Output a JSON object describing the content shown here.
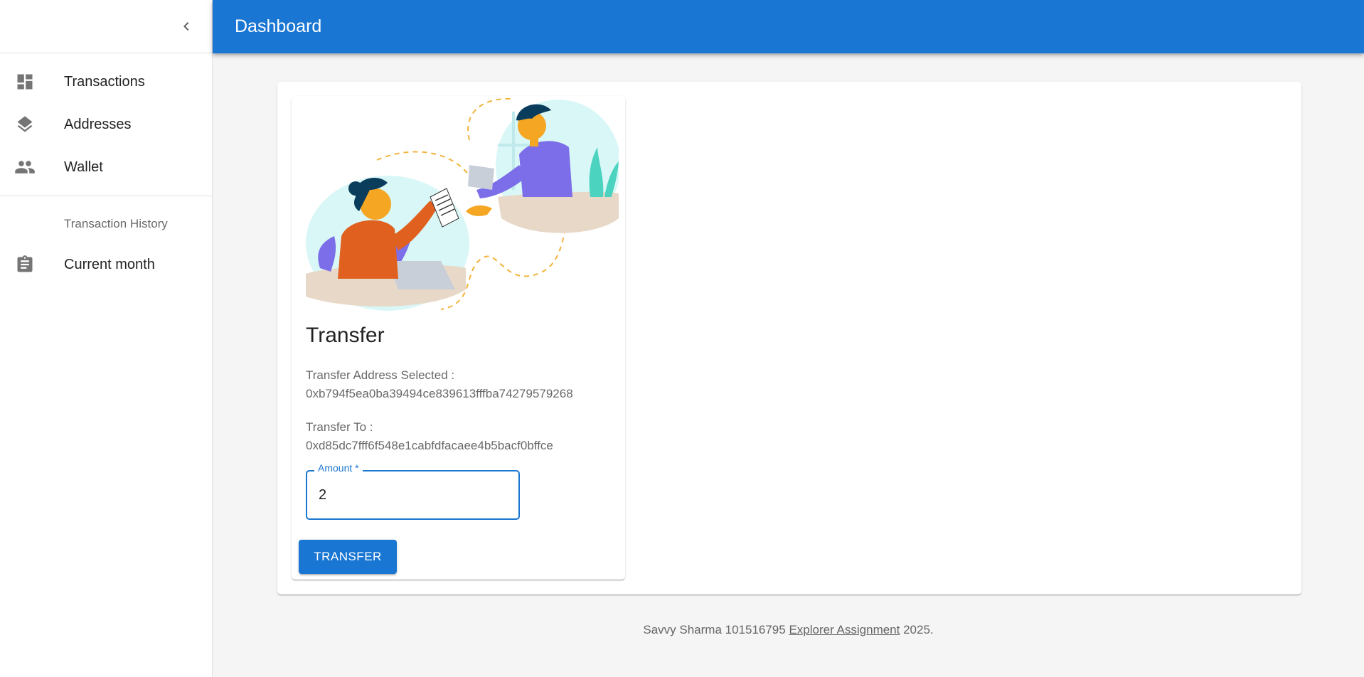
{
  "appbar": {
    "title": "Dashboard"
  },
  "sidebar": {
    "items": [
      {
        "label": "Transactions",
        "icon": "dashboard-icon"
      },
      {
        "label": "Addresses",
        "icon": "layers-icon"
      },
      {
        "label": "Wallet",
        "icon": "people-icon"
      }
    ],
    "subheader": "Transaction History",
    "history_items": [
      {
        "label": "Current month",
        "icon": "assignment-icon"
      }
    ]
  },
  "transfer": {
    "title": "Transfer",
    "address_selected_label": "Transfer Address Selected :",
    "address_selected_value": "0xb794f5ea0ba39494ce839613fffba74279579268",
    "to_label": "Transfer To :",
    "to_value": "0xd85dc7fff6f548e1cabfdfacaee4b5bacf0bffce",
    "amount_label": "Amount *",
    "amount_value": "2",
    "button_label": "TRANSFER"
  },
  "footer": {
    "prefix": "Savvy Sharma 101516795",
    "link_text": "Explorer Assignment",
    "suffix": "2025."
  },
  "colors": {
    "primary": "#1976d2",
    "background": "#f5f5f5"
  }
}
